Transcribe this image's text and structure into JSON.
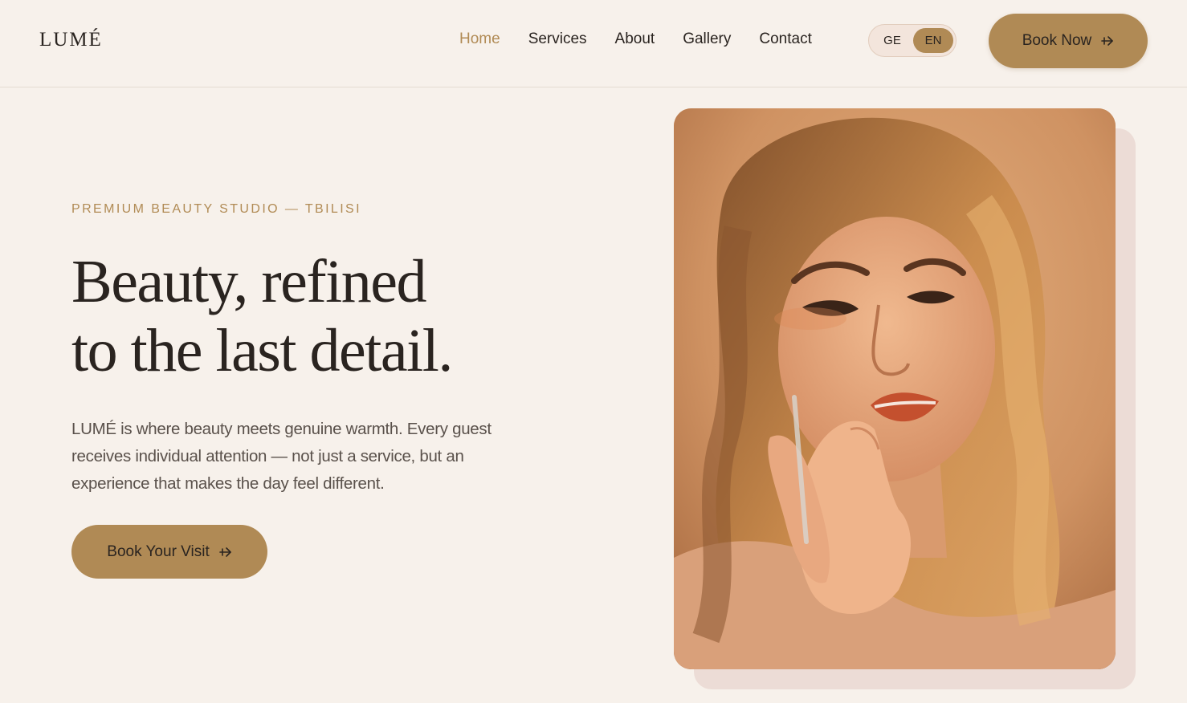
{
  "brand": {
    "logo": "LUMÉ"
  },
  "nav": {
    "items": [
      {
        "label": "Home",
        "active": true
      },
      {
        "label": "Services",
        "active": false
      },
      {
        "label": "About",
        "active": false
      },
      {
        "label": "Gallery",
        "active": false
      },
      {
        "label": "Contact",
        "active": false
      }
    ]
  },
  "language": {
    "options": [
      "GE",
      "EN"
    ],
    "selected": "EN"
  },
  "header": {
    "book_now_label": "Book Now",
    "book_now_icon": "arrow-right-icon"
  },
  "hero": {
    "eyebrow": "PREMIUM BEAUTY STUDIO — TBILISI",
    "headline_line1": "Beauty, refined",
    "headline_line2": "to the last detail.",
    "lead": "LUMÉ is where beauty meets genuine warmth. Every guest receives individual attention — not just a service, but an experience that makes the day feel different.",
    "cta_label": "Book Your Visit",
    "cta_icon": "arrow-right-icon"
  },
  "colors": {
    "background": "#f7f1eb",
    "accent": "#b08a55",
    "text": "#2a2420",
    "muted_text": "#5a514b"
  }
}
